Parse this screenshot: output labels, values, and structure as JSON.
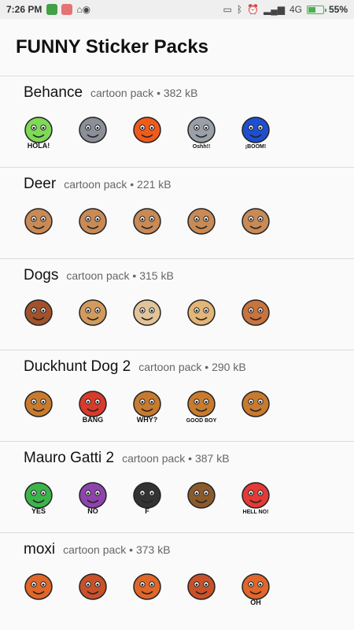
{
  "status_bar": {
    "time": "7:26 PM",
    "network": "4G",
    "battery": "55%",
    "battery_level": 0.55,
    "icons": [
      "notification-s-icon",
      "notification-calendar-icon",
      "home-icon",
      "android-icon",
      "vibrate-icon",
      "bluetooth-icon",
      "alarm-icon",
      "signal-icon",
      "battery-icon"
    ]
  },
  "header": {
    "title": "FUNNY Sticker Packs"
  },
  "packs": [
    {
      "name": "Behance",
      "meta": "cartoon pack • 382 kB",
      "stickers": [
        {
          "icon": "alien-hola-sticker",
          "text": "HOLA!",
          "color": "#7ed957"
        },
        {
          "icon": "wolf-tongue-sticker",
          "text": "",
          "color": "#8a8f98"
        },
        {
          "icon": "flame-sticker",
          "text": "",
          "color": "#f05a1a"
        },
        {
          "icon": "cat-oshh-sticker",
          "text": "Oshh!!",
          "color": "#9aa0a8"
        },
        {
          "icon": "boom-sticker",
          "text": "¡BOOM!",
          "color": "#1e4fd0"
        }
      ]
    },
    {
      "name": "Deer",
      "meta": "cartoon pack • 221 kB",
      "stickers": [
        {
          "icon": "deer-face-1-sticker",
          "text": "",
          "color": "#c98a55"
        },
        {
          "icon": "deer-face-2-sticker",
          "text": "",
          "color": "#c98a55"
        },
        {
          "icon": "deer-face-3-sticker",
          "text": "",
          "color": "#c98a55"
        },
        {
          "icon": "deer-face-4-sticker",
          "text": "",
          "color": "#c98a55"
        },
        {
          "icon": "deer-face-5-sticker",
          "text": "",
          "color": "#c98a55"
        }
      ]
    },
    {
      "name": "Dogs",
      "meta": "cartoon pack • 315 kB",
      "stickers": [
        {
          "icon": "bloodhound-sticker",
          "text": "",
          "color": "#a1522b"
        },
        {
          "icon": "beagle-sunglasses-sticker",
          "text": "",
          "color": "#d29a5c"
        },
        {
          "icon": "pug-sticker",
          "text": "",
          "color": "#e2c49a"
        },
        {
          "icon": "labrador-sticker",
          "text": "",
          "color": "#e3b577"
        },
        {
          "icon": "beagle-glasses-sticker",
          "text": "",
          "color": "#c9733d"
        }
      ]
    },
    {
      "name": "Duckhunt Dog 2",
      "meta": "cartoon pack • 290 kB",
      "stickers": [
        {
          "icon": "duckhunt-grass-sticker",
          "text": "",
          "color": "#c87b2e"
        },
        {
          "icon": "duckhunt-bang-sticker",
          "text": "BANG",
          "color": "#d93a2b"
        },
        {
          "icon": "duckhunt-why-sticker",
          "text": "WHY?",
          "color": "#c87b2e"
        },
        {
          "icon": "duckhunt-goodboy-sticker",
          "text": "GOOD BOY",
          "color": "#c87b2e"
        },
        {
          "icon": "duckhunt-salute-sticker",
          "text": "",
          "color": "#c87b2e"
        }
      ]
    },
    {
      "name": "Mauro Gatti 2",
      "meta": "cartoon pack • 387 kB",
      "stickers": [
        {
          "icon": "yes-letters-sticker",
          "text": "YES",
          "color": "#3cb44b"
        },
        {
          "icon": "no-letters-sticker",
          "text": "NO",
          "color": "#8e44ad"
        },
        {
          "icon": "bomb-sticker",
          "text": "F",
          "color": "#333333"
        },
        {
          "icon": "poop-sticker",
          "text": "",
          "color": "#8b5a2b"
        },
        {
          "icon": "hell-no-cat-sticker",
          "text": "HELL NO!",
          "color": "#e53935"
        }
      ]
    },
    {
      "name": "moxi",
      "meta": "cartoon pack • 373 kB",
      "stickers": [
        {
          "icon": "fox-sitting-sticker",
          "text": "",
          "color": "#e0662a"
        },
        {
          "icon": "fox-waving-sticker",
          "text": "",
          "color": "#c9512a"
        },
        {
          "icon": "fox-running-sticker",
          "text": "",
          "color": "#e0662a"
        },
        {
          "icon": "fox-jumping-sticker",
          "text": "",
          "color": "#c9512a"
        },
        {
          "icon": "fox-oh-sticker",
          "text": "OH",
          "color": "#e0662a"
        }
      ]
    }
  ]
}
